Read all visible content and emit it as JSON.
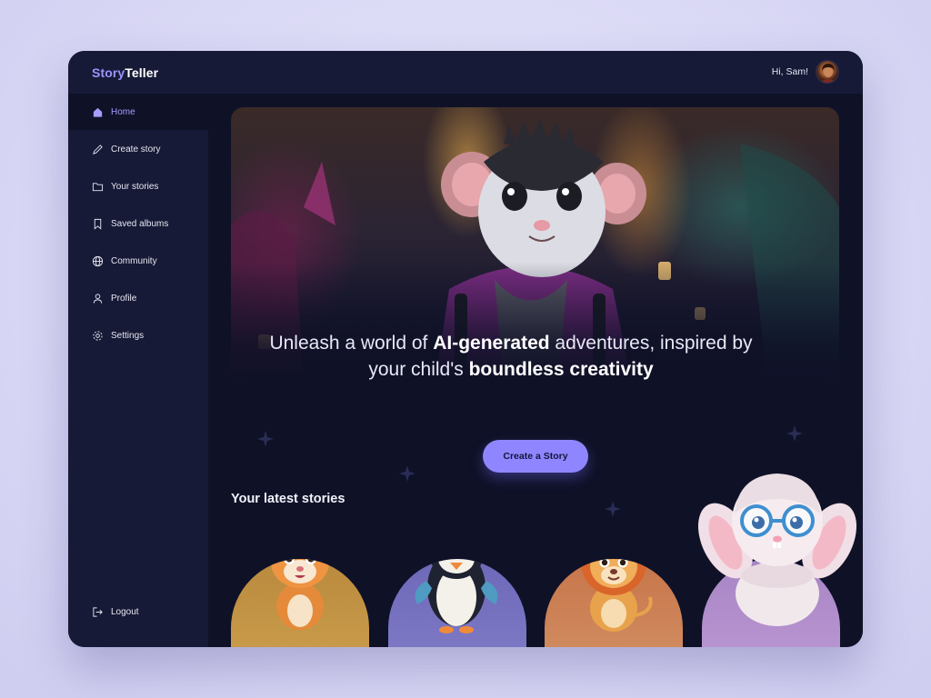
{
  "app": {
    "brand_part1": "Story",
    "brand_part2": "Teller",
    "greeting": "Hi, Sam!"
  },
  "sidebar": {
    "items": [
      {
        "label": "Home",
        "icon": "home-icon",
        "active": true
      },
      {
        "label": "Create story",
        "icon": "pencil-icon",
        "active": false
      },
      {
        "label": "Your stories",
        "icon": "folder-icon",
        "active": false
      },
      {
        "label": "Saved albums",
        "icon": "bookmark-icon",
        "active": false
      },
      {
        "label": "Community",
        "icon": "globe-icon",
        "active": false
      },
      {
        "label": "Profile",
        "icon": "user-icon",
        "active": false
      },
      {
        "label": "Settings",
        "icon": "gear-icon",
        "active": false
      }
    ],
    "logout": {
      "label": "Logout",
      "icon": "logout-icon"
    }
  },
  "hero": {
    "line1_a": "Unleash a world of ",
    "line1_b": "AI-generated",
    "line1_c": " adventures, inspired by",
    "line2_a": "your child's ",
    "line2_b": "boundless creativity",
    "cta_label": "Create a Story"
  },
  "latest": {
    "title": "Your latest stories",
    "cards": [
      {
        "character": "tiger-cub",
        "color": "#b9893d"
      },
      {
        "character": "penguin-with-headphones",
        "color": "#6d68b8"
      },
      {
        "character": "lion-cub",
        "color": "#c7754a"
      },
      {
        "character": "bunny-with-glasses",
        "color": "#a784c4"
      }
    ]
  },
  "colors": {
    "accent": "#8f86ff",
    "background": "#0f1127",
    "sidebar": "#171a36",
    "active_text": "#a79cff"
  }
}
